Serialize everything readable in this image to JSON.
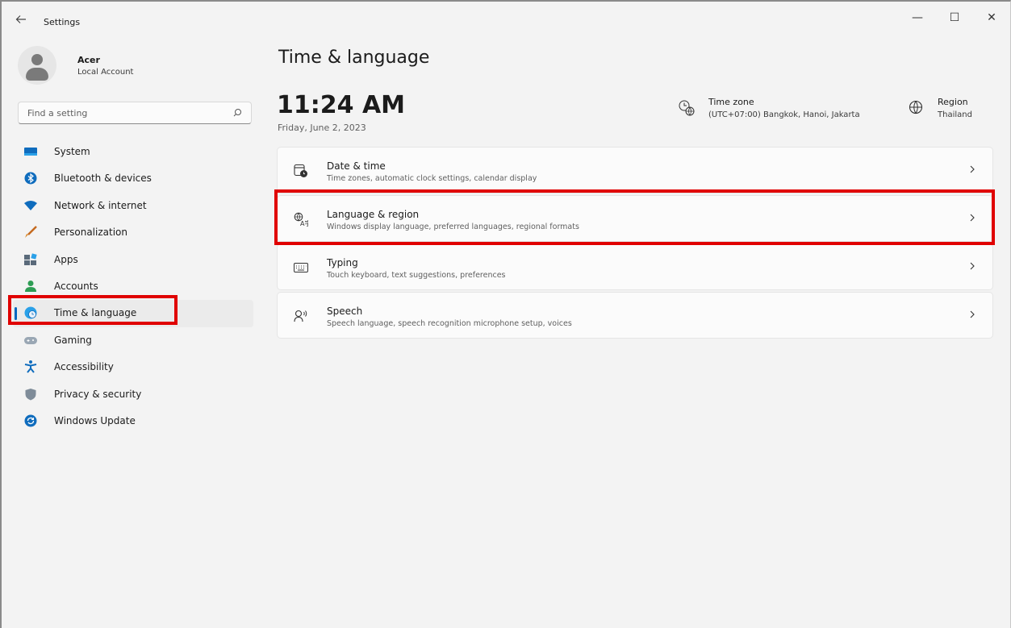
{
  "window": {
    "title": "Settings",
    "back_icon": "arrow-left-icon",
    "controls": {
      "minimize": "—",
      "maximize": "☐",
      "close": "✕"
    }
  },
  "profile": {
    "name": "Acer",
    "account_type": "Local Account"
  },
  "search": {
    "placeholder": "Find a setting"
  },
  "sidebar": {
    "items": [
      {
        "label": "System",
        "icon": "system-display-icon"
      },
      {
        "label": "Bluetooth & devices",
        "icon": "bluetooth-icon"
      },
      {
        "label": "Network & internet",
        "icon": "wifi-icon"
      },
      {
        "label": "Personalization",
        "icon": "paintbrush-icon"
      },
      {
        "label": "Apps",
        "icon": "apps-icon"
      },
      {
        "label": "Accounts",
        "icon": "person-icon"
      },
      {
        "label": "Time & language",
        "icon": "globe-clock-icon",
        "selected": true
      },
      {
        "label": "Gaming",
        "icon": "gamepad-icon"
      },
      {
        "label": "Accessibility",
        "icon": "accessibility-icon"
      },
      {
        "label": "Privacy & security",
        "icon": "shield-icon"
      },
      {
        "label": "Windows Update",
        "icon": "update-icon"
      }
    ]
  },
  "main": {
    "title": "Time & language",
    "clock": "11:24 AM",
    "date": "Friday, June 2, 2023",
    "time_zone": {
      "label": "Time zone",
      "value": "(UTC+07:00) Bangkok, Hanoi, Jakarta"
    },
    "region": {
      "label": "Region",
      "value": "Thailand"
    },
    "cards": [
      {
        "title": "Date & time",
        "subtitle": "Time zones, automatic clock settings, calendar display",
        "icon": "calendar-clock-icon"
      },
      {
        "title": "Language & region",
        "subtitle": "Windows display language, preferred languages, regional formats",
        "icon": "language-icon"
      },
      {
        "title": "Typing",
        "subtitle": "Touch keyboard, text suggestions, preferences",
        "icon": "keyboard-icon"
      },
      {
        "title": "Speech",
        "subtitle": "Speech language, speech recognition microphone setup, voices",
        "icon": "speech-icon"
      }
    ]
  },
  "colors": {
    "accent": "#0067c0",
    "highlight": "#e00000",
    "background": "#f3f3f3",
    "card": "#fbfbfb"
  }
}
